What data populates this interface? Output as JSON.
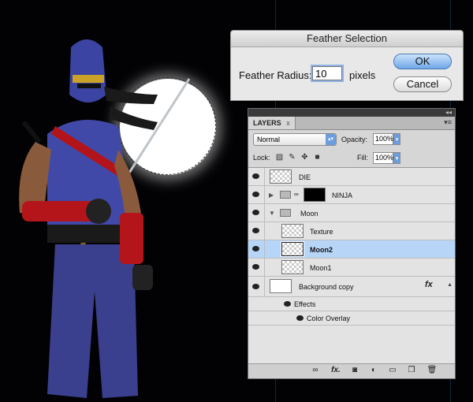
{
  "dialog": {
    "title": "Feather Selection",
    "label": "Feather Radius:",
    "value": "10",
    "units": "pixels",
    "ok_label": "OK",
    "cancel_label": "Cancel"
  },
  "layers_panel": {
    "tab_label": "LAYERS",
    "tab_close": "x",
    "blend_mode": "Normal",
    "opacity_label": "Opacity:",
    "opacity_value": "100%",
    "lock_label": "Lock:",
    "fill_label": "Fill:",
    "fill_value": "100%",
    "layers": [
      {
        "name": "DIE"
      },
      {
        "name": "NINJA"
      },
      {
        "name": "Moon"
      },
      {
        "name": "Texture"
      },
      {
        "name": "Moon2"
      },
      {
        "name": "Moon1"
      },
      {
        "name": "Background copy"
      }
    ],
    "effects_label": "Effects",
    "effect_item": "Color Overlay",
    "fx_glyph": "fx"
  },
  "colors": {
    "selection": "#b7d5f7",
    "ok_button": "#6ea6e6",
    "ninja_suit": "#3d47a8",
    "ninja_red": "#c0161b"
  }
}
